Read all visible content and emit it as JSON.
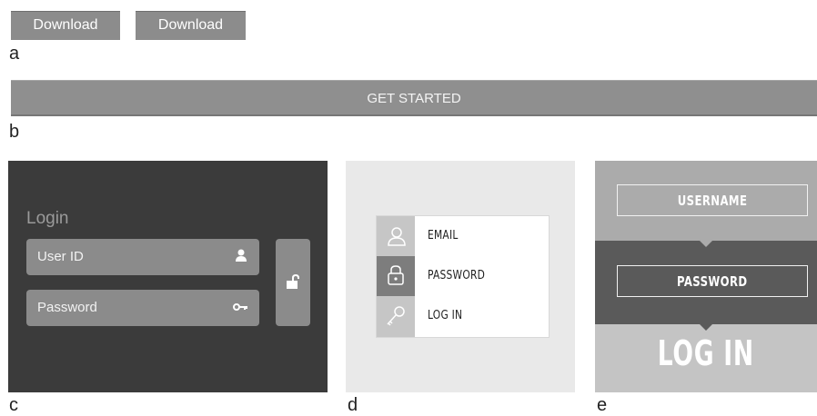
{
  "panel_a": {
    "label": "a",
    "buttons": [
      "Download",
      "Download"
    ]
  },
  "panel_b": {
    "label": "b",
    "button": "GET STARTED"
  },
  "panel_c": {
    "label": "c",
    "title": "Login",
    "user_field": "User ID",
    "password_field": "Password",
    "icons": [
      "user-icon",
      "key-icon",
      "unlock-icon"
    ]
  },
  "panel_d": {
    "label": "d",
    "rows": [
      "EMAIL",
      "PASSWORD",
      "LOG IN"
    ],
    "icons": [
      "user-outline-icon",
      "lock-icon",
      "key-outline-icon"
    ]
  },
  "panel_e": {
    "label": "e",
    "username": "USERNAME",
    "password": "PASSWORD",
    "login": "LOG IN"
  }
}
